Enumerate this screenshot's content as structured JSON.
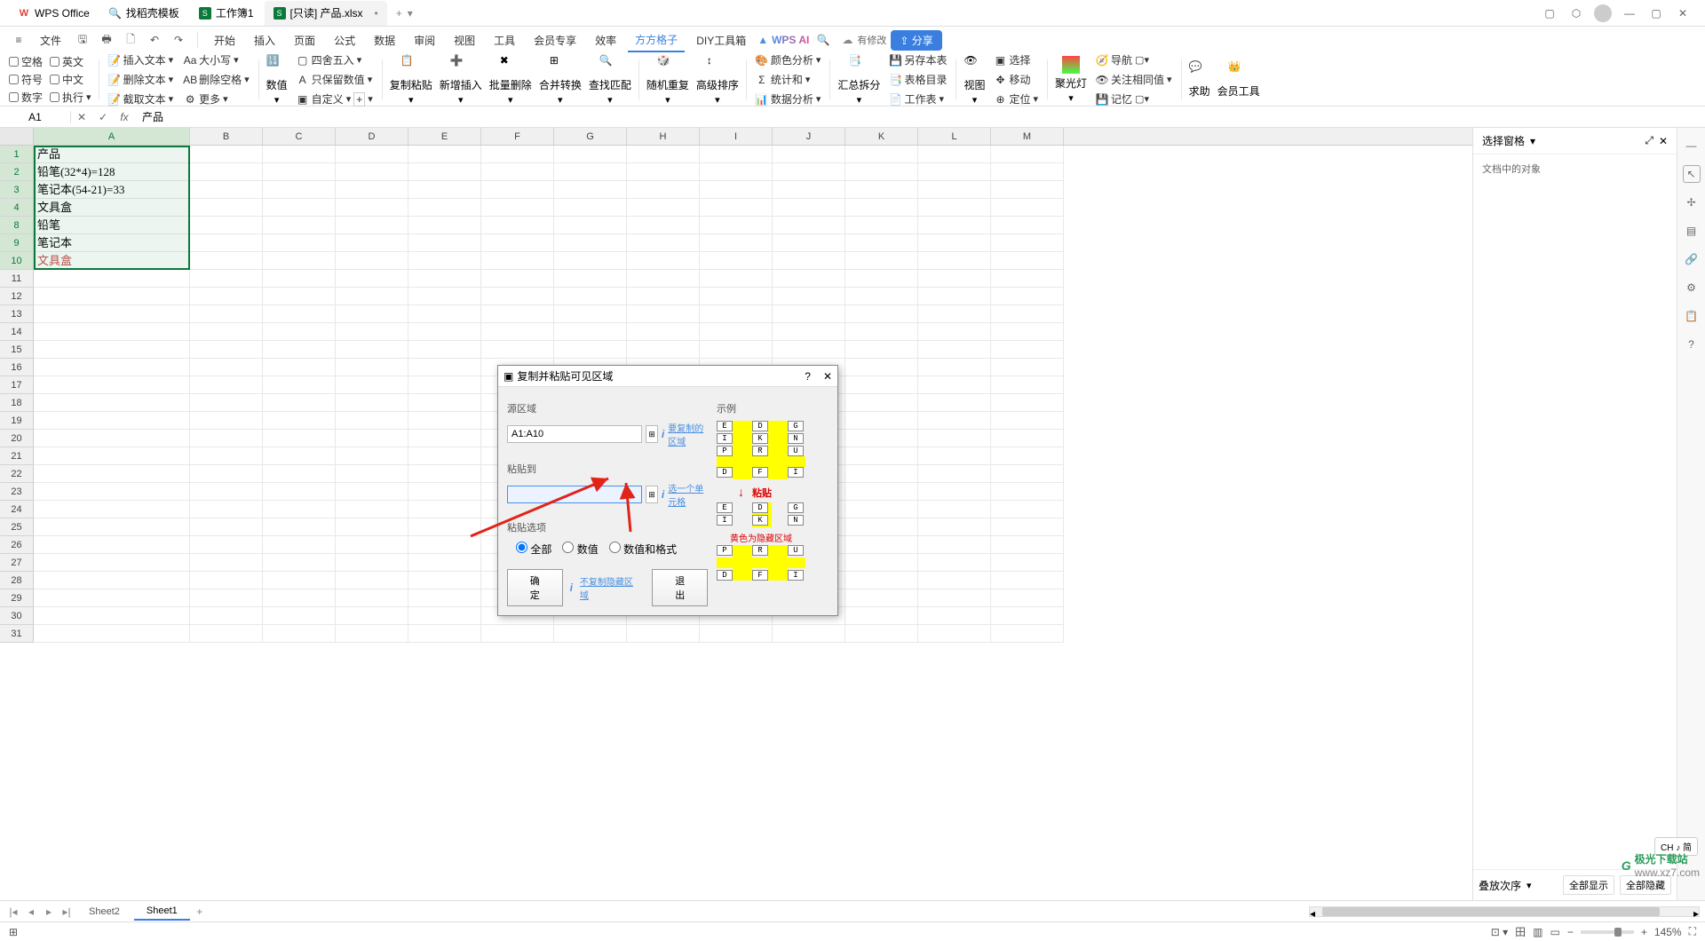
{
  "title_tabs": [
    {
      "icon": "W",
      "iconColor": "#d9463d",
      "label": "WPS Office"
    },
    {
      "icon": "🔍",
      "iconColor": "#888",
      "label": "找稻壳模板"
    },
    {
      "icon": "S",
      "iconColor": "#0a7a3a",
      "label": "工作簿1"
    },
    {
      "icon": "S",
      "iconColor": "#0a7a3a",
      "label": "[只读] 产品.xlsx",
      "active": true
    }
  ],
  "window_controls": {
    "minimize": "—",
    "maximize": "▢",
    "close": "✕"
  },
  "file_menu": "文件",
  "menu_items": [
    "开始",
    "插入",
    "页面",
    "公式",
    "数据",
    "审阅",
    "视图",
    "工具",
    "会员专享",
    "效率",
    "方方格子",
    "DIY工具箱"
  ],
  "menu_active": "方方格子",
  "wps_ai": "WPS AI",
  "has_changes": "有修改",
  "share": "分享",
  "ribbon": {
    "checks_col1": [
      "空格",
      "符号",
      "数字"
    ],
    "checks_col2": [
      "英文",
      "中文",
      "执行"
    ],
    "text_ops": [
      "插入文本",
      "删除文本",
      "截取文本"
    ],
    "case_ops": [
      "大小写",
      "删除空格",
      "更多"
    ],
    "num_col": [
      "数值",
      "四舍五入",
      "只保留数值",
      "自定义"
    ],
    "large_btns": [
      "复制粘贴",
      "新增插入",
      "批量删除",
      "合并转换",
      "查找匹配",
      "随机重复",
      "高级排序"
    ],
    "analysis": [
      "颜色分析",
      "统计和",
      "数据分析"
    ],
    "exchange": "汇总拆分",
    "workbook": [
      "另存本表",
      "表格目录",
      "工作表"
    ],
    "view": [
      "视图",
      "选择",
      "移动",
      "定位"
    ],
    "spotlight": "聚光灯",
    "tools": [
      "导航",
      "关注相同值",
      "记忆"
    ],
    "help": "求助",
    "member": "会员工具"
  },
  "namebox": "A1",
  "formula_value": "产品",
  "columns": [
    "A",
    "B",
    "C",
    "D",
    "E",
    "F",
    "G",
    "H",
    "I",
    "J",
    "K",
    "L",
    "M"
  ],
  "row_numbers": [
    "1",
    "2",
    "3",
    "4",
    "8",
    "9",
    "10",
    "11",
    "12",
    "13",
    "14",
    "15",
    "16",
    "17",
    "18",
    "19",
    "20",
    "21",
    "22",
    "23",
    "24",
    "25",
    "26",
    "27",
    "28",
    "29",
    "30",
    "31"
  ],
  "cells": {
    "A1": "产品",
    "A2": "铅笔(32*4)=128",
    "A3": "笔记本(54-21)=33",
    "A4": "文具盒",
    "A8": "铅笔",
    "A9": "笔记本",
    "A10": "文具盒"
  },
  "dialog": {
    "title": "复制并粘贴可见区域",
    "help": "?",
    "close": "✕",
    "source_label": "源区域",
    "source_value": "A1:A10",
    "source_hint": "要复制的区域",
    "paste_label": "粘贴到",
    "paste_value": "",
    "paste_hint": "选一个单元格",
    "options_label": "粘贴选项",
    "opt_all": "全部",
    "opt_values": "数值",
    "opt_values_fmt": "数值和格式",
    "ok": "确定",
    "exit": "退出",
    "no_copy_hidden": "不复制隐藏区域",
    "example_label": "示例",
    "paste_arrow": "粘贴",
    "yellow_note": "黄色为隐藏区域",
    "ex_letters_top": [
      [
        "E",
        "D",
        "G"
      ],
      [
        "I",
        "K",
        "N"
      ],
      [
        "P",
        "R",
        "U"
      ],
      [
        "D",
        "F",
        "I"
      ]
    ],
    "ex_letters_mid": [
      [
        "E",
        "D",
        "G"
      ],
      [
        "I",
        "K",
        "N"
      ]
    ],
    "ex_letters_bot": [
      [
        "P",
        "R",
        "U"
      ],
      [
        "D",
        "F",
        "I"
      ]
    ]
  },
  "sidepanel": {
    "title": "选择窗格",
    "body": "文档中的对象",
    "stack": "叠放次序",
    "show_all": "全部显示",
    "hide_all": "全部隐藏"
  },
  "sheets": {
    "sheet2": "Sheet2",
    "sheet1": "Sheet1"
  },
  "status": {
    "zoom": "145%"
  },
  "ime": "CH ♪ 简",
  "watermark": {
    "brand": "极光下载站",
    "url": "www.xz7.com"
  }
}
